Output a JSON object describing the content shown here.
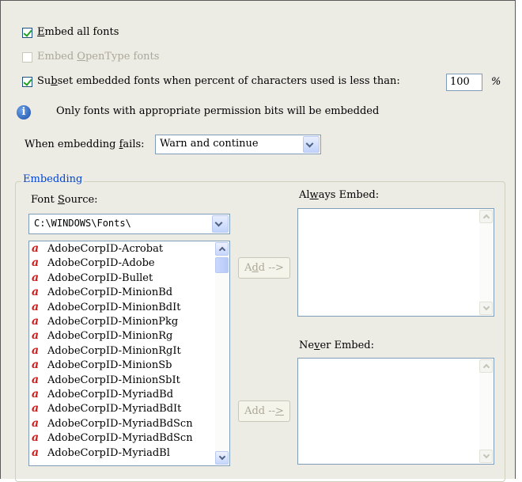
{
  "options": {
    "embed_all_fonts": {
      "label_pre": "",
      "label_u": "E",
      "label_post": "mbed all fonts",
      "checked": true
    },
    "embed_opentype": {
      "label_pre": "Embed ",
      "label_u": "O",
      "label_post": "penType fonts",
      "checked": false
    },
    "subset_fonts": {
      "label_pre": "Su",
      "label_u": "b",
      "label_post": "set embedded fonts when percent of characters used is less than:",
      "checked": true
    },
    "subset_percent_value": "100",
    "percent_symbol": "%"
  },
  "info": {
    "icon": "info-icon",
    "text": "Only fonts with appropriate permission bits will be embedded"
  },
  "embedding_fails": {
    "label_pre": "When embedding ",
    "label_u": "f",
    "label_post": "ails:",
    "value": "Warn and continue"
  },
  "embedding_group": {
    "title": "Embedding",
    "font_source_pre": "Font ",
    "font_source_u": "S",
    "font_source_post": "ource:",
    "font_source_value": "C:\\WINDOWS\\Fonts\\",
    "fonts": [
      "AdobeCorpID-Acrobat",
      "AdobeCorpID-Adobe",
      "AdobeCorpID-Bullet",
      "AdobeCorpID-MinionBd",
      "AdobeCorpID-MinionBdIt",
      "AdobeCorpID-MinionPkg",
      "AdobeCorpID-MinionRg",
      "AdobeCorpID-MinionRgIt",
      "AdobeCorpID-MinionSb",
      "AdobeCorpID-MinionSbIt",
      "AdobeCorpID-MyriadBd",
      "AdobeCorpID-MyriadBdIt",
      "AdobeCorpID-MyriadBdScn",
      "AdobeCorpID-MyriadBdScn",
      "AdobeCorpID-MyriadBl"
    ],
    "add_always": {
      "pre": "A",
      "u": "d",
      "post": "d -->"
    },
    "add_never": {
      "pre": "Add --",
      "u": ">",
      "post": ""
    },
    "always_embed": {
      "pre": "Al",
      "u": "w",
      "post": "ays Embed:"
    },
    "never_embed": {
      "pre": "Ne",
      "u": "v",
      "post": "er Embed:"
    }
  }
}
